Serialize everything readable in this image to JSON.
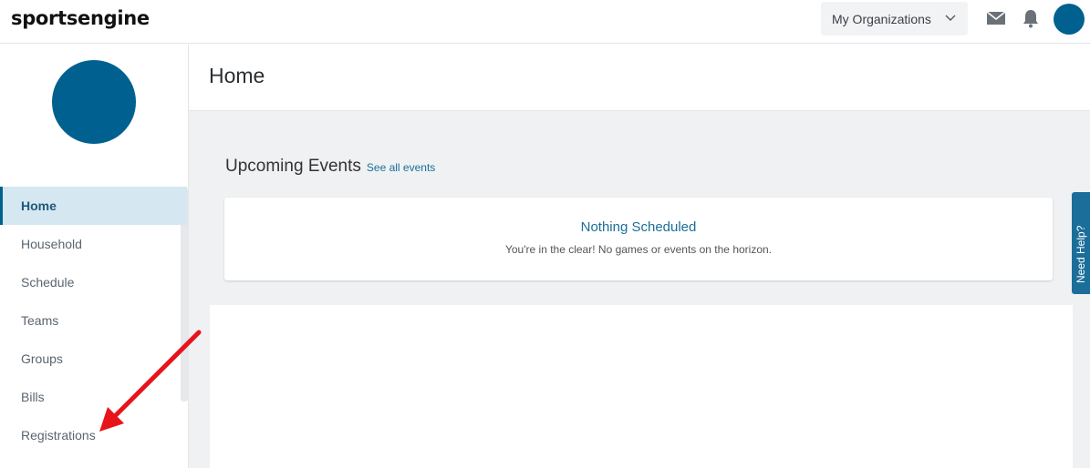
{
  "header": {
    "logo_text": "sportsengine",
    "org_menu_label": "My Organizations",
    "icons": [
      "mail-icon",
      "bell-icon",
      "chevron-down-icon"
    ]
  },
  "sidebar": {
    "items": [
      {
        "label": "Home",
        "active": true
      },
      {
        "label": "Household",
        "active": false
      },
      {
        "label": "Schedule",
        "active": false
      },
      {
        "label": "Teams",
        "active": false
      },
      {
        "label": "Groups",
        "active": false
      },
      {
        "label": "Bills",
        "active": false
      },
      {
        "label": "Registrations",
        "active": false
      }
    ]
  },
  "main": {
    "page_title": "Home",
    "section_title": "Upcoming Events",
    "see_all_label": "See all events",
    "empty_title": "Nothing Scheduled",
    "empty_message": "You're in the clear! No games or events on the horizon."
  },
  "help_tab_label": "Need Help?",
  "colors": {
    "brand": "#00608f",
    "link": "#1b6e99",
    "active_bg": "#d5e7f0",
    "annotation_arrow": "#e8141b"
  }
}
